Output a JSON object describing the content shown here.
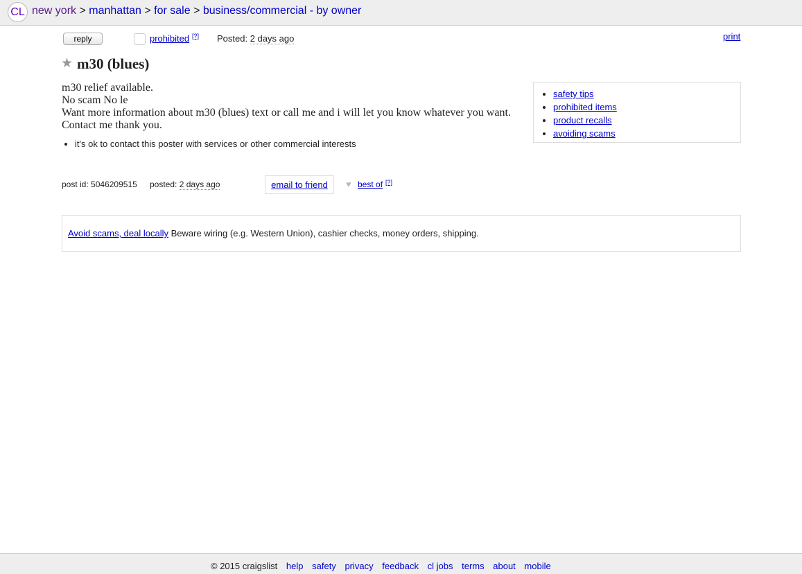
{
  "header": {
    "logo": "CL",
    "breadcrumbs": [
      "new york",
      "manhattan",
      "for sale",
      "business/commercial - by owner"
    ],
    "separator": ">"
  },
  "actions": {
    "reply_label": "reply",
    "prohibited_label": "prohibited",
    "help_mark": "[?]",
    "posted_label": "Posted:",
    "posted_value": "2 days ago",
    "print_label": "print"
  },
  "post": {
    "title": "m30 (blues)",
    "body_lines": [
      "m30 relief available.",
      "No scam No le",
      "Want more information about m30 (blues) text or call me and i will let you know whatever you want.",
      "Contact me thank you."
    ],
    "notices": [
      "it's ok to contact this poster with services or other commercial interests"
    ]
  },
  "sidebar": {
    "links": [
      "safety tips",
      "prohibited items",
      "product recalls",
      "avoiding scams"
    ]
  },
  "postinfo": {
    "id_label": "post id:",
    "id_value": "5046209515",
    "posted_label": "posted:",
    "posted_value": "2 days ago",
    "email_label": "email to friend",
    "bestof_label": "best of",
    "help_mark": "[?]"
  },
  "scam_banner": {
    "link": "Avoid scams, deal locally",
    "text": "Beware wiring (e.g. Western Union), cashier checks, money orders, shipping."
  },
  "footer": {
    "copyright": "© 2015 craigslist",
    "links": [
      "help",
      "safety",
      "privacy",
      "feedback",
      "cl jobs",
      "terms",
      "about",
      "mobile"
    ]
  },
  "colors": {
    "link": "#0000cc",
    "visited": "#551a8b",
    "bar": "#eeeeee"
  }
}
